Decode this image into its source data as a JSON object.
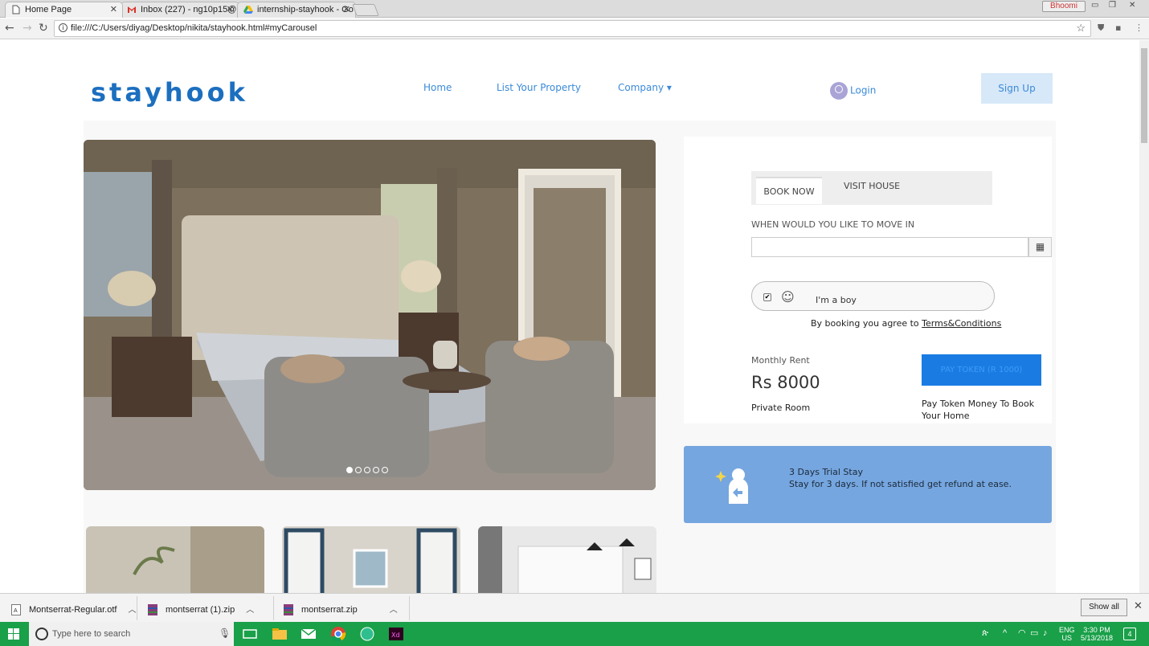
{
  "browser": {
    "tabs": [
      {
        "label": "Home Page"
      },
      {
        "label": "Inbox (227) - ng10p15@"
      },
      {
        "label": "internship-stayhook - Go"
      }
    ],
    "url": "file:///C:/Users/diyag/Desktop/nikita/stayhook.html#myCarousel",
    "user_badge": "Bhoomi"
  },
  "site": {
    "logo": "stayhook",
    "nav": [
      {
        "label": "Home"
      },
      {
        "label": "List Your Property"
      },
      {
        "label": "Company ▾"
      }
    ],
    "login": "Login",
    "signup": "Sign Up"
  },
  "carousel": {
    "slides": 5,
    "active": 1
  },
  "booking": {
    "tab_book": "BOOK NOW",
    "tab_visit": "VISIT HOUSE",
    "move_in_label": "WHEN WOULD YOU LIKE TO MOVE IN",
    "move_in_value": "",
    "gender_label": "I'm a boy",
    "agree_text": "By booking you agree to ",
    "agree_link": "Terms&Conditions",
    "rent_label": "Monthly Rent",
    "rent_value": "Rs 8000",
    "room_type": "Private Room",
    "pay_button": "PAY TOKEN (R 1000)",
    "pay_note": "Pay Token Money To Book Your Home"
  },
  "trial": {
    "title": "3 Days Trial Stay",
    "desc": "Stay for 3 days. If not satisfied get refund at ease."
  },
  "downloads": {
    "items": [
      {
        "name": "Montserrat-Regular.otf"
      },
      {
        "name": "montserrat (1).zip"
      },
      {
        "name": "montserrat.zip"
      }
    ],
    "show_all": "Show all"
  },
  "taskbar": {
    "search_placeholder": "Type here to search",
    "lang": "ENG",
    "region": "US",
    "time": "3:30 PM",
    "date": "5/13/2018",
    "notif": "4"
  },
  "colors": {
    "brand": "#1c6fbf",
    "accent": "#3b8ad8",
    "pay": "#1a7ce3",
    "trial": "#76a6df",
    "taskbar": "#19a048"
  }
}
